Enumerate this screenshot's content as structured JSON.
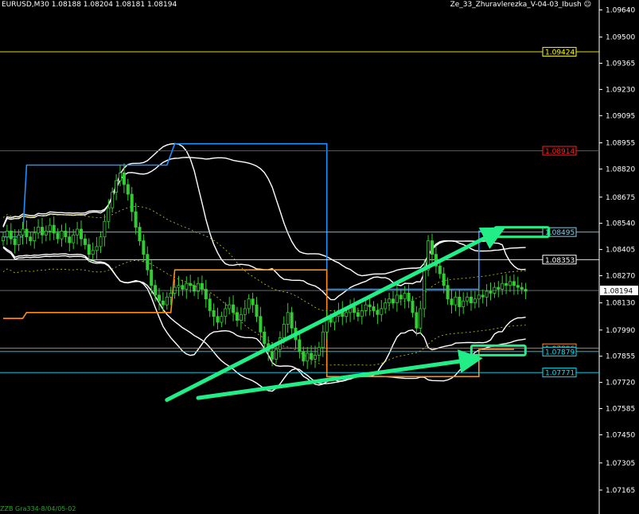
{
  "header": {
    "symbol": "EURUSD,M30",
    "ohlc": "1.08188 1.08204 1.08181 1.08194",
    "indicator": "Ze_33_Zhuravlerezka_V-04-03_Ibush"
  },
  "footer": {
    "note": "ZZB Gra334-8/04/05-02"
  },
  "colors": {
    "background": "#000000",
    "candle": "#32cd32",
    "bands": "#ffffff",
    "blue_channel": "#1e90ff",
    "orange_channel": "#ff8c1a",
    "arrows": "#22ee88",
    "axis": "#ffffff"
  },
  "chart_data": {
    "type": "candlestick",
    "title": "",
    "symbol": "EURUSD",
    "timeframe": "M30",
    "ylim": [
      1.0705,
      1.0965
    ],
    "y_ticks": [
      "1.09640",
      "1.09500",
      "1.09365",
      "1.09230",
      "1.09095",
      "1.08955",
      "1.08820",
      "1.08675",
      "1.08540",
      "1.08405",
      "1.08270",
      "1.08130",
      "1.07990",
      "1.07855",
      "1.07720",
      "1.07585",
      "1.07450",
      "1.07305",
      "1.07165"
    ],
    "current_price": "1.08194",
    "price_levels": [
      {
        "label": "1.09424",
        "value": 1.09424,
        "color": "#ffff00",
        "line": "#ffff00"
      },
      {
        "label": "1.08914",
        "value": 1.08914,
        "color": "#ff2020",
        "line": "#ff2020"
      },
      {
        "label": "1.08495",
        "value": 1.08495,
        "color": "#87ceeb",
        "line": "#87ceeb"
      },
      {
        "label": "1.08353",
        "value": 1.08353,
        "color": "#ffffff",
        "line": "#ffffff"
      },
      {
        "label": "1.07896",
        "value": 1.07896,
        "color": "#ff8c1a",
        "line": "#ff8c1a"
      },
      {
        "label": "1.07879",
        "value": 1.07879,
        "color": "#00e5ff",
        "line": "#00e5ff"
      },
      {
        "label": "1.07771",
        "value": 1.07771,
        "color": "#00e5ff",
        "line": "#00e5ff"
      }
    ],
    "annotations": [
      {
        "type": "arrow",
        "from_bar": 42,
        "from_price": 1.0763,
        "to_bar": 127,
        "to_price": 1.085
      },
      {
        "type": "arrow",
        "from_bar": 50,
        "from_price": 1.0764,
        "to_bar": 121,
        "to_price": 1.0784
      },
      {
        "type": "marker",
        "bar": 133,
        "price": 1.08495
      },
      {
        "type": "marker",
        "bar": 127,
        "price": 1.07885
      }
    ],
    "trendlines_anchor_x_bars": 135,
    "closes": [
      1.0847,
      1.085,
      1.0846,
      1.0843,
      1.0848,
      1.0851,
      1.0847,
      1.0845,
      1.0849,
      1.0852,
      1.0848,
      1.085,
      1.0853,
      1.0849,
      1.0846,
      1.085,
      1.0847,
      1.0844,
      1.0848,
      1.0851,
      1.0846,
      1.0843,
      1.0838,
      1.084,
      1.0842,
      1.0847,
      1.0855,
      1.0862,
      1.087,
      1.0876,
      1.088,
      1.0874,
      1.0869,
      1.086,
      1.0852,
      1.0845,
      1.0838,
      1.083,
      1.0822,
      1.0817,
      1.0814,
      1.0812,
      1.0816,
      1.0818,
      1.0821,
      1.0822,
      1.082,
      1.0823,
      1.0822,
      1.0819,
      1.0823,
      1.082,
      1.0815,
      1.0809,
      1.0806,
      1.0803,
      1.0806,
      1.081,
      1.0812,
      1.0808,
      1.0804,
      1.0807,
      1.081,
      1.0815,
      1.0812,
      1.0806,
      1.0798,
      1.0792,
      1.0788,
      1.0784,
      1.0789,
      1.0795,
      1.0802,
      1.0808,
      1.08,
      1.0794,
      1.0788,
      1.0783,
      1.0787,
      1.0784,
      1.0786,
      1.079,
      1.0798,
      1.0805,
      1.0803,
      1.0806,
      1.0809,
      1.0806,
      1.0808,
      1.0811,
      1.0808,
      1.0806,
      1.0809,
      1.0812,
      1.0811,
      1.0809,
      1.0807,
      1.081,
      1.0813,
      1.0815,
      1.0813,
      1.0817,
      1.0815,
      1.0818,
      1.0814,
      1.0808,
      1.08,
      1.081,
      1.083,
      1.0845,
      1.0838,
      1.0832,
      1.0828,
      1.0822,
      1.0815,
      1.0812,
      1.0816,
      1.0811,
      1.0814,
      1.0816,
      1.0813,
      1.0815,
      1.0817,
      1.0816,
      1.0819,
      1.0818,
      1.0821,
      1.082,
      1.0823,
      1.0822,
      1.0824,
      1.0822,
      1.0821,
      1.082,
      1.0819
    ]
  }
}
